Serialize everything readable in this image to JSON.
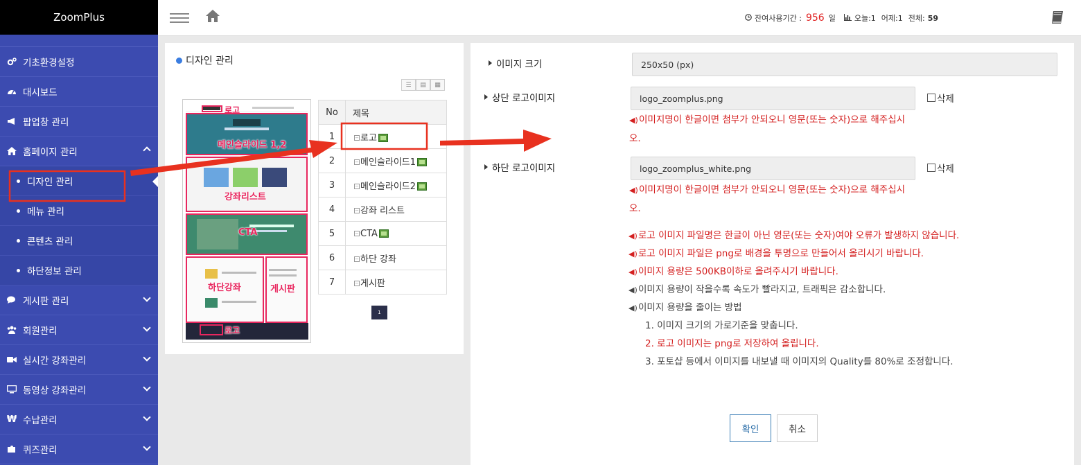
{
  "brand": "ZoomPlus",
  "sidebar": {
    "items": [
      {
        "label": "기초환경설정"
      },
      {
        "label": "대시보드"
      },
      {
        "label": "팝업창 관리"
      },
      {
        "label": "홈페이지 관리"
      },
      {
        "label": "게시판 관리"
      },
      {
        "label": "회원관리"
      },
      {
        "label": "실시간 강좌관리"
      },
      {
        "label": "동영상 강좌관리"
      },
      {
        "label": "수납관리"
      },
      {
        "label": "퀴즈관리"
      }
    ],
    "sub_items": [
      {
        "label": "디자인 관리"
      },
      {
        "label": "메뉴 관리"
      },
      {
        "label": "콘텐츠 관리"
      },
      {
        "label": "하단정보 관리"
      }
    ]
  },
  "header": {
    "remain_label": "잔여사용기간 :",
    "remain_value": "956",
    "remain_unit": "일",
    "today_label": "오늘:1",
    "yesterday_label": "어제:1",
    "total_label": "전체:",
    "total_value": "59"
  },
  "design": {
    "title": "디자인 관리",
    "preview_labels": {
      "logo_top": "로고",
      "main_slide": "메인슬라이드 1,2",
      "course_list": "강좌리스트",
      "cta": "CTA",
      "bottom_course": "하단강좌",
      "board": "게시판",
      "logo_bottom": "로고"
    },
    "table": {
      "headers": [
        "No",
        "제목"
      ],
      "rows": [
        {
          "no": "1",
          "title": "로고",
          "has_image": true
        },
        {
          "no": "2",
          "title": "메인슬라이드1",
          "has_image": true
        },
        {
          "no": "3",
          "title": "메인슬라이드2",
          "has_image": true
        },
        {
          "no": "4",
          "title": "강좌 리스트",
          "has_image": false
        },
        {
          "no": "5",
          "title": "CTA",
          "has_image": true
        },
        {
          "no": "6",
          "title": "하단 강좌",
          "has_image": false
        },
        {
          "no": "7",
          "title": "게시판",
          "has_image": false
        }
      ]
    },
    "pagination": "1"
  },
  "form": {
    "size_label": "이미지 크기",
    "size_value": "250x50 (px)",
    "top_logo_label": "상단 로고이미지",
    "top_logo_value": "logo_zoomplus.png",
    "bottom_logo_label": "하단 로고이미지",
    "bottom_logo_value": "logo_zoomplus_white.png",
    "delete_label": "삭제",
    "filename_warning_line1": "이미지명이 한글이면 첨부가 안되오니 영문(또는 숫자)으로 해주십시",
    "filename_warning_line2": "오.",
    "notes": [
      {
        "text": "로고 이미지 파일명은 한글이 아닌 영문(또는 숫자)여야 오류가 발생하지 않습니다.",
        "tone": "red"
      },
      {
        "text": "로고 이미지 파일은 png로 배경을 투명으로 만들어서 올리시기 바랍니다.",
        "tone": "red"
      },
      {
        "text": "이미지 용량은 500KB이하로 올려주시기 바랍니다.",
        "tone": "red"
      },
      {
        "text": "이미지 용량이 작을수록 속도가 빨라지고, 트래픽은 감소합니다.",
        "tone": "gray"
      },
      {
        "text": "이미지 용량을 줄이는 방법",
        "tone": "gray"
      }
    ],
    "steps": [
      {
        "text": "1. 이미지 크기의 가로기준을 맞춥니다.",
        "tone": "gray"
      },
      {
        "text": "2. 로고 이미지는 png로 저장하여 올립니다.",
        "tone": "red"
      },
      {
        "text": "3. 포토샵 등에서 이미지를 내보낼 때 이미지의 Quality를 80%로 조정합니다.",
        "tone": "gray"
      }
    ],
    "confirm_label": "확인",
    "cancel_label": "취소"
  },
  "colors": {
    "sidebar": "#3c4bb0",
    "annotation": "#e8311f",
    "warning": "#d42020",
    "accent": "#3a7de0"
  }
}
